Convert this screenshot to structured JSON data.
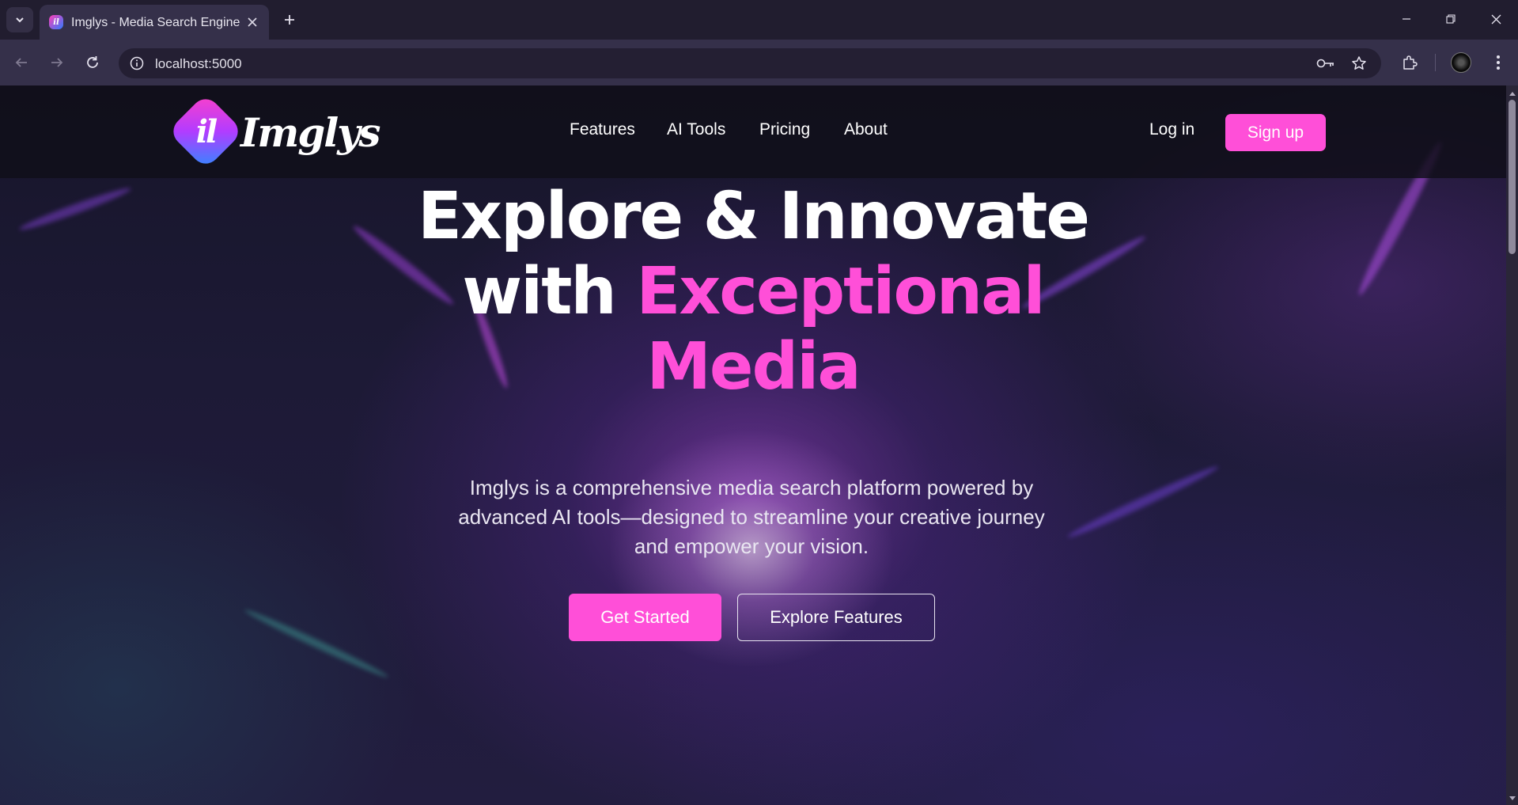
{
  "browser": {
    "tab_title": "Imglys - Media Search Engine",
    "url": "localhost:5000"
  },
  "site": {
    "brand": "Imglys",
    "logo_glyph": "il",
    "nav": [
      "Features",
      "AI Tools",
      "Pricing",
      "About"
    ],
    "login": "Log in",
    "signup": "Sign up"
  },
  "hero": {
    "line1": "Explore & Innovate",
    "line2_prefix": "with",
    "line2_accent": "Exceptional",
    "line3_accent": "Media",
    "subtitle": "Imglys is a comprehensive media search platform powered by advanced AI tools—designed to streamline your creative journey and empower your vision.",
    "cta_primary": "Get Started",
    "cta_secondary": "Explore Features"
  },
  "colors": {
    "accent": "#ff4fd8",
    "tab_bg": "#35304a",
    "tabstrip_bg": "#211d2f"
  },
  "icons": [
    "tab-search-icon",
    "close-icon",
    "plus-icon",
    "minimize-icon",
    "restore-icon",
    "back-icon",
    "forward-icon",
    "reload-icon",
    "info-icon",
    "key-icon",
    "star-icon",
    "extensions-icon",
    "kebab-menu-icon"
  ]
}
